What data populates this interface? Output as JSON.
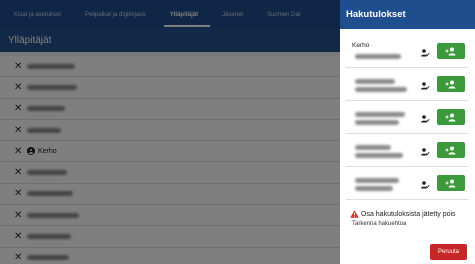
{
  "tabs": [
    {
      "label": "Kisat ja asetukset"
    },
    {
      "label": "Pelipaikat ja digikirjaus"
    },
    {
      "label": "Ylläpitäjät"
    },
    {
      "label": "Jäsenet"
    },
    {
      "label": "Suomen Dar"
    }
  ],
  "section_title": "Ylläpitäjät",
  "admin_rows": [
    {
      "text": "",
      "has_icon": false
    },
    {
      "text": "",
      "has_icon": false
    },
    {
      "text": "",
      "has_icon": false
    },
    {
      "text": "",
      "has_icon": false
    },
    {
      "text": "Kerho",
      "has_icon": true
    },
    {
      "text": "",
      "has_icon": false
    },
    {
      "text": "",
      "has_icon": false
    },
    {
      "text": "",
      "has_icon": false
    },
    {
      "text": "",
      "has_icon": false
    },
    {
      "text": "",
      "has_icon": false
    }
  ],
  "panel": {
    "title": "Hakutulokset",
    "results": [
      {
        "name": "Kerho"
      },
      {
        "name": ""
      },
      {
        "name": ""
      },
      {
        "name": ""
      },
      {
        "name": ""
      }
    ],
    "warning_text": "Osa hakutuloksista jätetty pois",
    "refine_text": "Tarkenna hakuehtoa",
    "cancel_label": "Peruuta"
  },
  "colors": {
    "header_blue": "#1e4d8c",
    "add_green": "#3c9a3c",
    "cancel_red": "#c62828",
    "warning_red": "#d32f2f"
  },
  "icons": {
    "remove": "close-icon",
    "person": "person-icon",
    "verify": "person-check-icon",
    "add": "person-add-icon",
    "warning": "warning-icon"
  }
}
